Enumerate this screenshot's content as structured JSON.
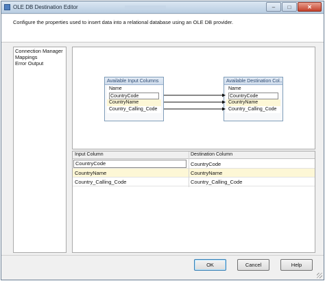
{
  "window": {
    "title": "OLE DB Destination Editor"
  },
  "header": {
    "description": "Configure the properties used to insert data into a relational database using an OLE DB provider."
  },
  "nav": {
    "items": [
      {
        "label": "Connection Manager"
      },
      {
        "label": "Mappings"
      },
      {
        "label": "Error Output"
      }
    ]
  },
  "mapping": {
    "input_box": {
      "title": "Available Input Columns",
      "header": "Name",
      "columns": [
        "CountryCode",
        "CountryName",
        "Country_Calling_Code"
      ]
    },
    "destination_box": {
      "title": "Available Destination Col...",
      "header": "Name",
      "columns": [
        "CountryCode",
        "CountryName",
        "Country_Calling_Code"
      ]
    }
  },
  "grid": {
    "headers": {
      "input": "Input Column",
      "destination": "Destination Column"
    },
    "rows": [
      {
        "input": "CountryCode",
        "destination": "CountryCode"
      },
      {
        "input": "CountryName",
        "destination": "CountryName"
      },
      {
        "input": "Country_Calling_Code",
        "destination": "Country_Calling_Code"
      }
    ]
  },
  "buttons": {
    "ok": "OK",
    "cancel": "Cancel",
    "help": "Help"
  },
  "colors": {
    "highlight_row": "#fdf7d6",
    "box_title": "#2e4b73",
    "window_border": "#6b7f94"
  }
}
